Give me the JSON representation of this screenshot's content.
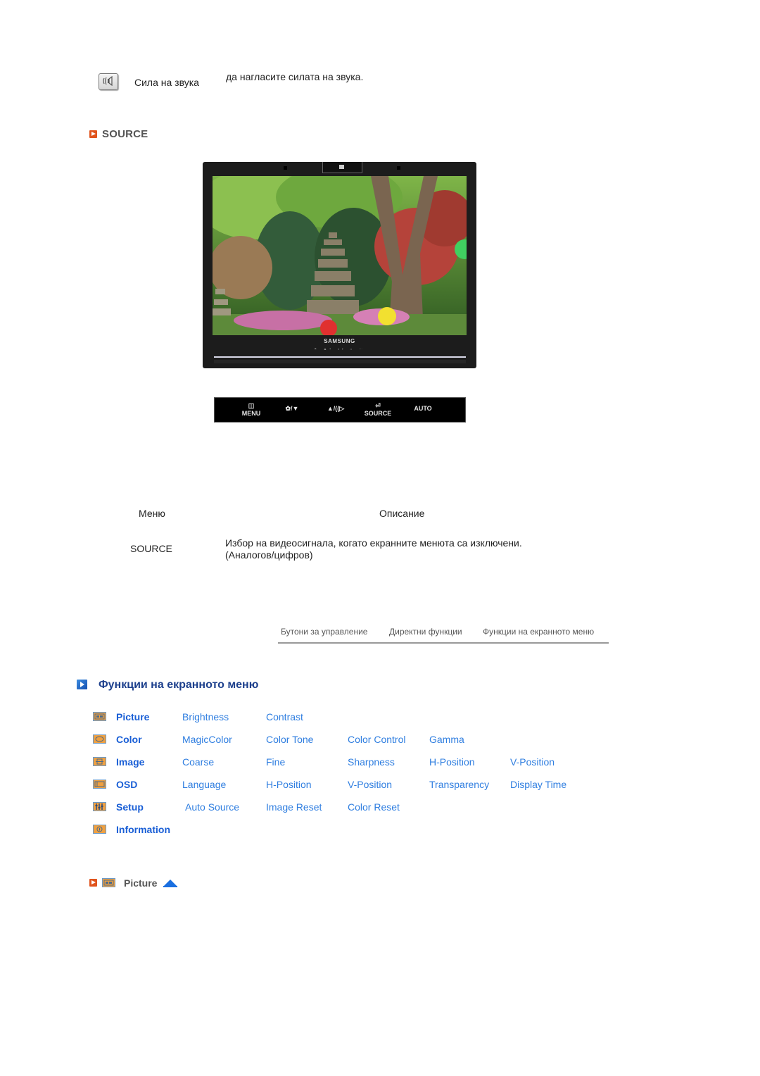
{
  "volume_row": {
    "icon": "volume-icon",
    "label": "Сила на звука",
    "description": "да нагласите силата на звука."
  },
  "source_section": {
    "title": "SOURCE",
    "monitor": {
      "brand": "SAMSUNG",
      "front_icons": "⏶ ▲▪ ◂▸ ⌂ ⋯"
    },
    "button_strip": [
      {
        "icon": "menu-icon",
        "glyph": "◫",
        "label": "MENU"
      },
      {
        "icon": "magicbright-down-icon",
        "glyph": "",
        "label": "✿/▼"
      },
      {
        "icon": "up-volume-icon",
        "glyph": "",
        "label": "▲/((▷"
      },
      {
        "icon": "source-icon",
        "glyph": "⏎",
        "label": "SOURCE"
      },
      {
        "icon": "auto-icon",
        "glyph": "",
        "label": "AUTO"
      }
    ]
  },
  "table": {
    "headers": {
      "menu": "Меню",
      "description": "Описание"
    },
    "rows": [
      {
        "menu": "SOURCE",
        "description_line1": "Избор на видеосигнала, когато екранните менюта са изключени.",
        "description_line2": "(Аналогов/цифров)"
      }
    ]
  },
  "nav_tabs": [
    "Бутони за управление",
    "Директни функции",
    "Функции на екранното меню"
  ],
  "osd": {
    "title": "Функции на екранното меню",
    "menus": [
      {
        "icon": "picture-icon",
        "name": "Picture",
        "items": [
          "Brightness",
          "Contrast"
        ]
      },
      {
        "icon": "color-icon",
        "name": "Color",
        "items": [
          "MagicColor",
          "Color Tone",
          "Color Control",
          "Gamma"
        ]
      },
      {
        "icon": "image-icon",
        "name": "Image",
        "items": [
          "Coarse",
          "Fine",
          "Sharpness",
          "H-Position",
          "V-Position"
        ]
      },
      {
        "icon": "osd-icon",
        "name": "OSD",
        "items": [
          "Language",
          "H-Position",
          "V-Position",
          "Transparency",
          "Display Time"
        ]
      },
      {
        "icon": "setup-icon",
        "name": "Setup",
        "items": [
          "Auto Source",
          "Image Reset",
          "Color Reset"
        ]
      },
      {
        "icon": "information-icon",
        "name": "Information",
        "items": []
      }
    ]
  },
  "bottom_link": {
    "label": "Picture",
    "icon": "picture-icon",
    "up_icon": "up-arrow-icon"
  },
  "colors": {
    "accent_orange": "#e0531c",
    "link_blue": "#2f7ee0",
    "heading_blue": "#1a5fd6",
    "title_navy": "#1c3f8c"
  }
}
